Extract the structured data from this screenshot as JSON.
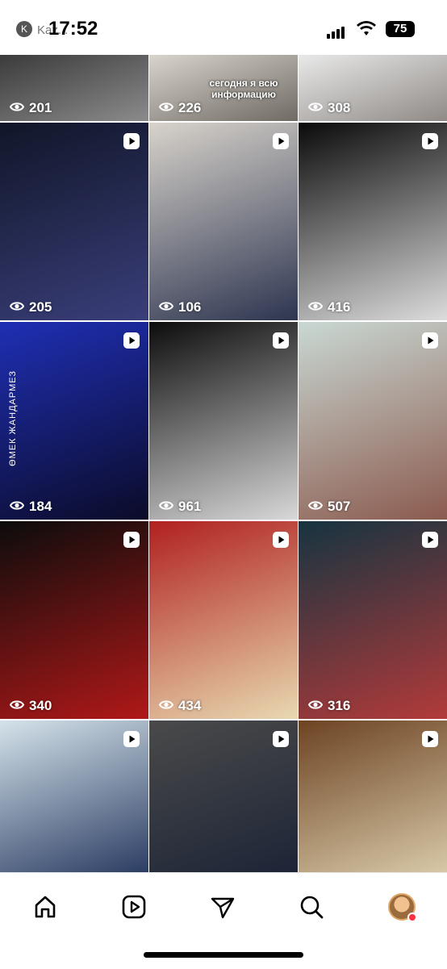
{
  "status_bar": {
    "time": "17:52",
    "app_badge": "K",
    "app_name": "Kaz...",
    "battery": "75"
  },
  "tiles": [
    {
      "views": "201",
      "is_reel": false,
      "colors": [
        "#3b3b3b",
        "#8b8b8b"
      ],
      "overlay": ""
    },
    {
      "views": "226",
      "is_reel": false,
      "colors": [
        "#d9d4cd",
        "#6f6a63"
      ],
      "overlay": "сегодня я всю информацию"
    },
    {
      "views": "308",
      "is_reel": false,
      "colors": [
        "#e9e9e9",
        "#8f8a86"
      ],
      "overlay": ""
    },
    {
      "views": "205",
      "is_reel": true,
      "colors": [
        "#101628",
        "#3a3e7a"
      ],
      "overlay": ""
    },
    {
      "views": "106",
      "is_reel": true,
      "colors": [
        "#d8d3cb",
        "#2d3550"
      ],
      "overlay": ""
    },
    {
      "views": "416",
      "is_reel": true,
      "colors": [
        "#0a0a0a",
        "#dcdcdc"
      ],
      "overlay": ""
    },
    {
      "views": "184",
      "is_reel": true,
      "colors": [
        "#1f2fb5",
        "#0b0b28"
      ],
      "overlay": "ӨМЕК ЖАНДАРМЕЗ"
    },
    {
      "views": "961",
      "is_reel": true,
      "colors": [
        "#0c0c0c",
        "#d8d8d8"
      ],
      "overlay": ""
    },
    {
      "views": "507",
      "is_reel": true,
      "colors": [
        "#c9d8d3",
        "#8b5b4f"
      ],
      "overlay": ""
    },
    {
      "views": "340",
      "is_reel": true,
      "colors": [
        "#0c0c0c",
        "#b01818"
      ],
      "overlay": ""
    },
    {
      "views": "434",
      "is_reel": true,
      "colors": [
        "#b02020",
        "#e8d9b0"
      ],
      "overlay": ""
    },
    {
      "views": "316",
      "is_reel": true,
      "colors": [
        "#163440",
        "#b23a3a"
      ],
      "overlay": ""
    },
    {
      "views": "",
      "is_reel": true,
      "colors": [
        "#d4e3ea",
        "#2b3c63"
      ],
      "overlay": ""
    },
    {
      "views": "",
      "is_reel": true,
      "colors": [
        "#4a4a4a",
        "#1c2436"
      ],
      "overlay": ""
    },
    {
      "views": "",
      "is_reel": true,
      "colors": [
        "#6c4322",
        "#d8c9a8"
      ],
      "overlay": ""
    }
  ],
  "nav": {
    "items": [
      "home-icon",
      "reels-icon",
      "send-icon",
      "search-icon",
      "profile-avatar"
    ]
  }
}
